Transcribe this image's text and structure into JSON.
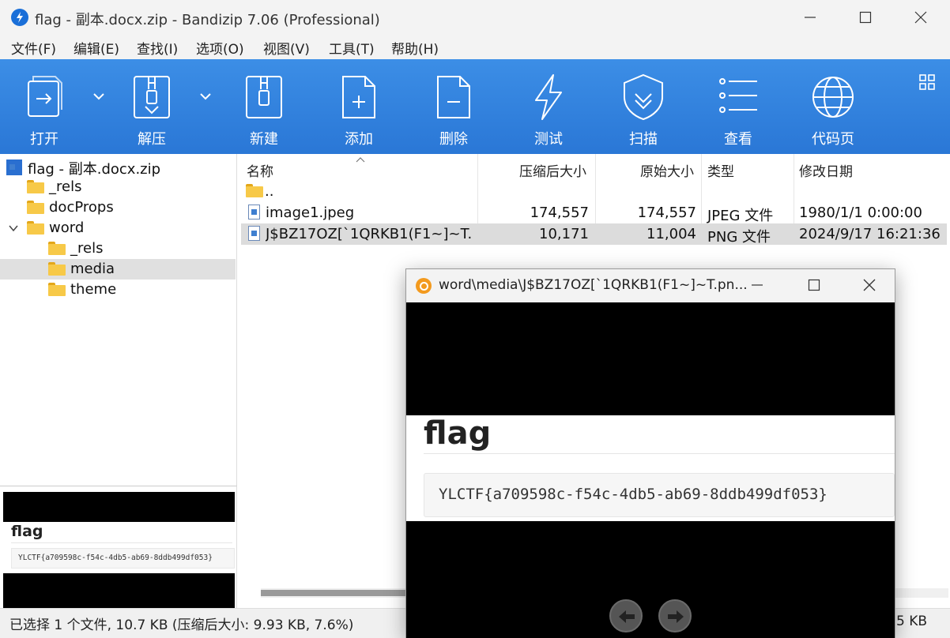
{
  "window": {
    "title": "flag - 副本.docx.zip - Bandizip 7.06 (Professional)"
  },
  "menu": [
    "文件(F)",
    "编辑(E)",
    "查找(I)",
    "选项(O)",
    "视图(V)",
    "工具(T)",
    "帮助(H)"
  ],
  "toolbar": {
    "open": "打开",
    "extract": "解压",
    "new": "新建",
    "add": "添加",
    "delete": "删除",
    "test": "测试",
    "scan": "扫描",
    "view": "查看",
    "codepage": "代码页"
  },
  "tree": {
    "root": "flag - 副本.docx.zip",
    "items": [
      "_rels",
      "docProps",
      "word",
      "_rels",
      "media",
      "theme"
    ]
  },
  "list": {
    "headers": [
      "名称",
      "压缩后大小",
      "原始大小",
      "类型",
      "修改日期"
    ],
    "up": "..",
    "rows": [
      {
        "name": "image1.jpeg",
        "packed": "174,557",
        "size": "174,557",
        "type": "JPEG 文件",
        "date": "1980/1/1 0:00:00"
      },
      {
        "name": "J$BZ17OZ[`1QRKB1(F1~]~T....",
        "packed": "10,171",
        "size": "11,004",
        "type": "PNG 文件",
        "date": "2024/9/17 16:21:36"
      }
    ]
  },
  "preview": {
    "heading": "flag",
    "code": "YLCTF{a709598c-f54c-4db5-ab69-8ddb499df053}"
  },
  "viewer": {
    "title": "word\\media\\J$BZ17OZ[`1QRKB1(F1~]~T.pn...",
    "heading": "flag",
    "code": "YLCTF{a709598c-f54c-4db5-ab69-8ddb499df053}"
  },
  "status": {
    "text": "已选择 1 个文件, 10.7 KB (压缩后大小: 9.93 KB, 7.6%)",
    "right": "5 KB"
  },
  "colors": {
    "toolbar": "#2a77d6",
    "folder": "#f7c948",
    "selection": "#dcdcdc"
  }
}
